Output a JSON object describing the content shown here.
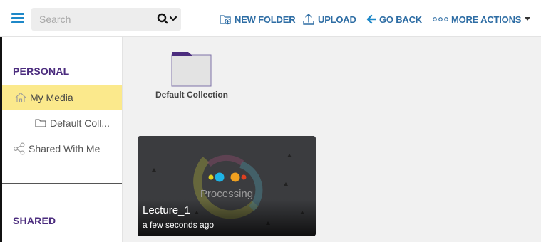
{
  "topbar": {
    "search_placeholder": "Search",
    "actions": {
      "new_folder": "NEW FOLDER",
      "upload": "UPLOAD",
      "go_back": "GO BACK",
      "more_actions": "MORE ACTIONS"
    }
  },
  "sidebar": {
    "personal_title": "PERSONAL",
    "items": [
      {
        "label": "My Media",
        "icon": "home-icon",
        "active": true
      },
      {
        "label": "Default Coll...",
        "icon": "folder-icon",
        "active": false
      },
      {
        "label": "Shared With Me",
        "icon": "share-icon",
        "active": false
      }
    ],
    "shared_title": "SHARED"
  },
  "main": {
    "folder": {
      "label": "Default Collection",
      "icon": "folder-icon"
    },
    "media_card": {
      "status": "Processing",
      "title": "Lecture_1",
      "time": "a few seconds ago"
    }
  },
  "colors": {
    "accent": "#2e6da4",
    "brand_purple": "#4b2c7e",
    "active_bg": "#fbe98c"
  }
}
